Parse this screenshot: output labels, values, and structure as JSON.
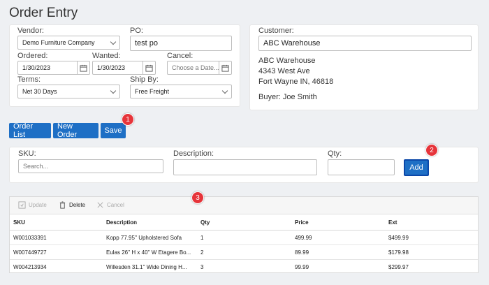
{
  "page": {
    "title": "Order Entry"
  },
  "order": {
    "vendor_label": "Vendor:",
    "vendor_value": "Demo Furniture Company",
    "po_label": "PO:",
    "po_value": "test po",
    "ordered_label": "Ordered:",
    "ordered_value": "1/30/2023",
    "wanted_label": "Wanted:",
    "wanted_value": "1/30/2023",
    "cancel_label": "Cancel:",
    "cancel_placeholder": "Choose a Date...",
    "terms_label": "Terms:",
    "terms_value": "Net 30 Days",
    "shipby_label": "Ship By:",
    "shipby_value": "Free Freight"
  },
  "customer": {
    "label": "Customer:",
    "value": "ABC Warehouse",
    "address_line1": "ABC Warehouse",
    "address_line2": "4343 West Ave",
    "address_line3": "Fort Wayne IN, 46818",
    "buyer": "Buyer: Joe Smith"
  },
  "actions": {
    "order_list": "Order List",
    "new_order": "New Order",
    "save": "Save"
  },
  "badges": {
    "b1": "1",
    "b2": "2",
    "b3": "3"
  },
  "line_entry": {
    "sku_label": "SKU:",
    "sku_placeholder": "Search...",
    "desc_label": "Description:",
    "qty_label": "Qty:",
    "add": "Add"
  },
  "grid": {
    "toolbar": {
      "update": "Update",
      "delete": "Delete",
      "cancel": "Cancel"
    },
    "columns": {
      "sku": "SKU",
      "description": "Description",
      "qty": "Qty",
      "price": "Price",
      "ext": "Ext"
    },
    "rows": [
      {
        "sku": "W001033391",
        "description": "Kopp 77.95'' Upholstered Sofa",
        "qty": "1",
        "price": "499.99",
        "ext": "$499.99"
      },
      {
        "sku": "W007449727",
        "description": "Eulas 26'' H x 40'' W Etagere Bo...",
        "qty": "2",
        "price": "89.99",
        "ext": "$179.98"
      },
      {
        "sku": "W004213934",
        "description": "Willesden 31.1'' Wide Dining H...",
        "qty": "3",
        "price": "99.99",
        "ext": "$299.97"
      }
    ]
  },
  "colors": {
    "primary": "#1e6fc5",
    "badge": "#e6343a",
    "background": "#eef0f3"
  }
}
